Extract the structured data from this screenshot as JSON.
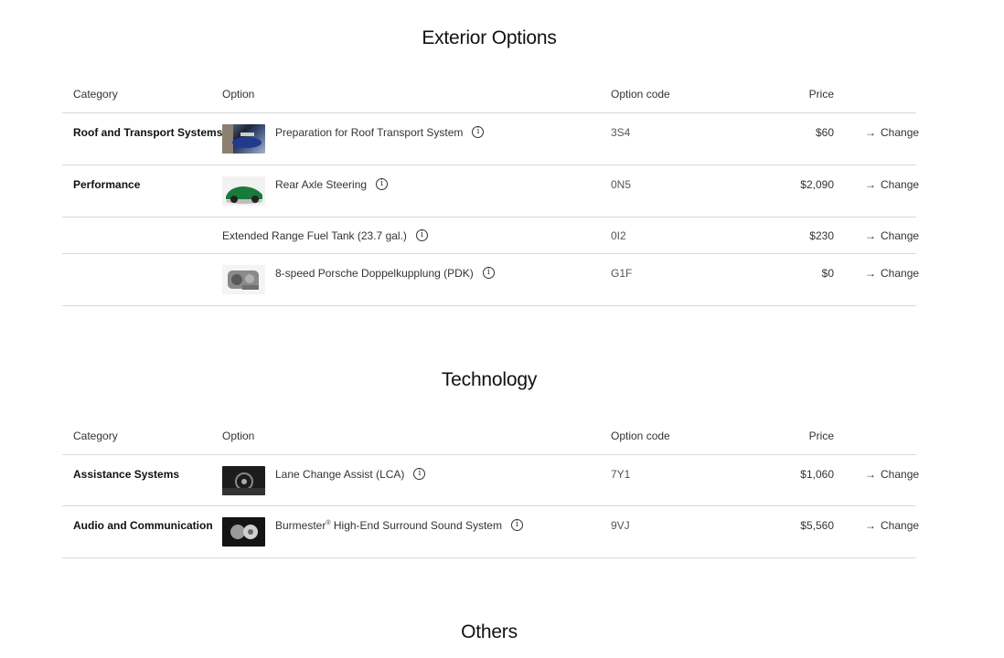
{
  "sections": [
    {
      "title": "Exterior Options",
      "headers": {
        "category": "Category",
        "option": "Option",
        "code": "Option code",
        "price": "Price"
      },
      "rows": [
        {
          "category": "Roof and Transport Systems",
          "option": "Preparation for Roof Transport System",
          "code": "3S4",
          "price": "$60",
          "change": "Change",
          "thumb_icon": "car-roof-thumbnail"
        },
        {
          "category": "Performance",
          "option": "Rear Axle Steering",
          "code": "0N5",
          "price": "$2,090",
          "change": "Change",
          "thumb_icon": "green-car-thumbnail"
        },
        {
          "category": "",
          "option": "Extended Range Fuel Tank (23.7 gal.)",
          "code": "0I2",
          "price": "$230",
          "change": "Change"
        },
        {
          "category": "",
          "option": "8-speed Porsche Doppelkupplung (PDK)",
          "code": "G1F",
          "price": "$0",
          "change": "Change",
          "thumb_icon": "gearbox-thumbnail"
        }
      ]
    },
    {
      "title": "Technology",
      "headers": {
        "category": "Category",
        "option": "Option",
        "code": "Option code",
        "price": "Price"
      },
      "rows": [
        {
          "category": "Assistance Systems",
          "option": "Lane Change Assist (LCA)",
          "code": "7Y1",
          "price": "$1,060",
          "change": "Change",
          "thumb_icon": "interior-thumbnail"
        },
        {
          "category": "Audio and Communication",
          "option_prefix": "Burmester",
          "option_sup": "®",
          "option_suffix": " High-End Surround Sound System",
          "code": "9VJ",
          "price": "$5,560",
          "change": "Change",
          "thumb_icon": "speaker-thumbnail"
        }
      ]
    },
    {
      "title": "Others"
    }
  ],
  "icons": {
    "info": "info-icon",
    "change": "arrow-right-icon"
  }
}
